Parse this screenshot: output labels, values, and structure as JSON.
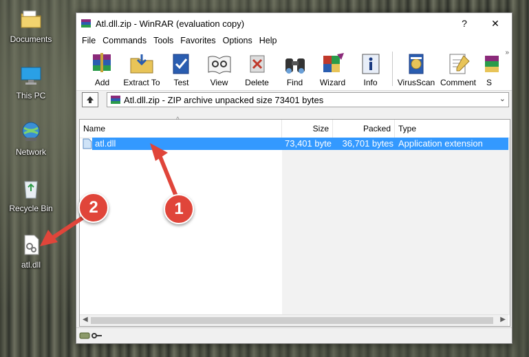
{
  "desktop": {
    "icons": [
      {
        "label": "Documents"
      },
      {
        "label": "This PC"
      },
      {
        "label": "Network"
      },
      {
        "label": "Recycle Bin"
      },
      {
        "label": "atl.dll"
      }
    ]
  },
  "window": {
    "title": "Atl.dll.zip - WinRAR (evaluation copy)",
    "help_button": "?",
    "close_button": "✕",
    "menu": [
      "File",
      "Commands",
      "Tools",
      "Favorites",
      "Options",
      "Help"
    ],
    "toolbar": [
      "Add",
      "Extract To",
      "Test",
      "View",
      "Delete",
      "Find",
      "Wizard",
      "Info",
      "VirusScan",
      "Comment",
      "S"
    ],
    "toolbar_more": "»",
    "address": "Atl.dll.zip - ZIP archive unpacked size 73401 bytes",
    "columns": {
      "name": "Name",
      "size": "Size",
      "packed": "Packed",
      "type": "Type"
    },
    "files": [
      {
        "name": "atl.dll",
        "size": "73,401 byte",
        "packed": "36,701 bytes",
        "type": "Application extension"
      }
    ]
  },
  "annotations": {
    "step1": "1",
    "step2": "2"
  },
  "colors": {
    "selection": "#3399ff",
    "badge": "#e0453a"
  }
}
